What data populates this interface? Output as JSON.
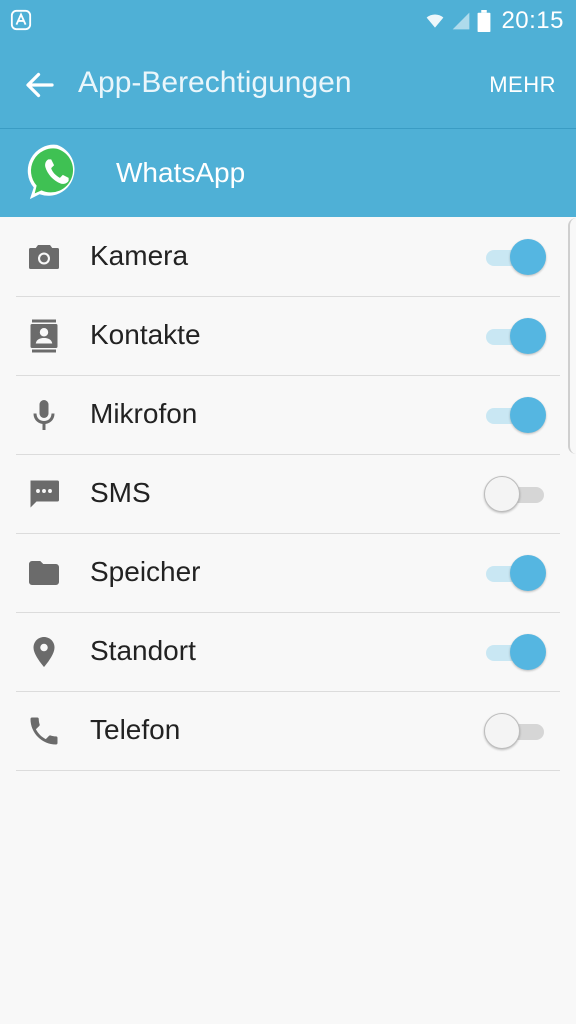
{
  "status_bar": {
    "time": "20:15",
    "icons": [
      "android-device-icon",
      "wifi-icon",
      "signal-icon",
      "battery-icon"
    ]
  },
  "app_bar": {
    "title": "App-Berechtigungen",
    "more_label": "MEHR",
    "back_icon": "arrow-back-icon"
  },
  "app": {
    "name": "WhatsApp",
    "icon": "whatsapp-logo-icon"
  },
  "colors": {
    "accent": "#4fb0d6",
    "toggle_on": "#55b6e1",
    "toggle_off": "#f4f4f4",
    "background": "#f8f8f8"
  },
  "permissions": [
    {
      "label": "Kamera",
      "icon": "camera-icon",
      "enabled": true
    },
    {
      "label": "Kontakte",
      "icon": "contacts-icon",
      "enabled": true
    },
    {
      "label": "Mikrofon",
      "icon": "microphone-icon",
      "enabled": true
    },
    {
      "label": "SMS",
      "icon": "sms-icon",
      "enabled": false
    },
    {
      "label": "Speicher",
      "icon": "folder-icon",
      "enabled": true
    },
    {
      "label": "Standort",
      "icon": "location-icon",
      "enabled": true
    },
    {
      "label": "Telefon",
      "icon": "phone-icon",
      "enabled": false
    }
  ]
}
